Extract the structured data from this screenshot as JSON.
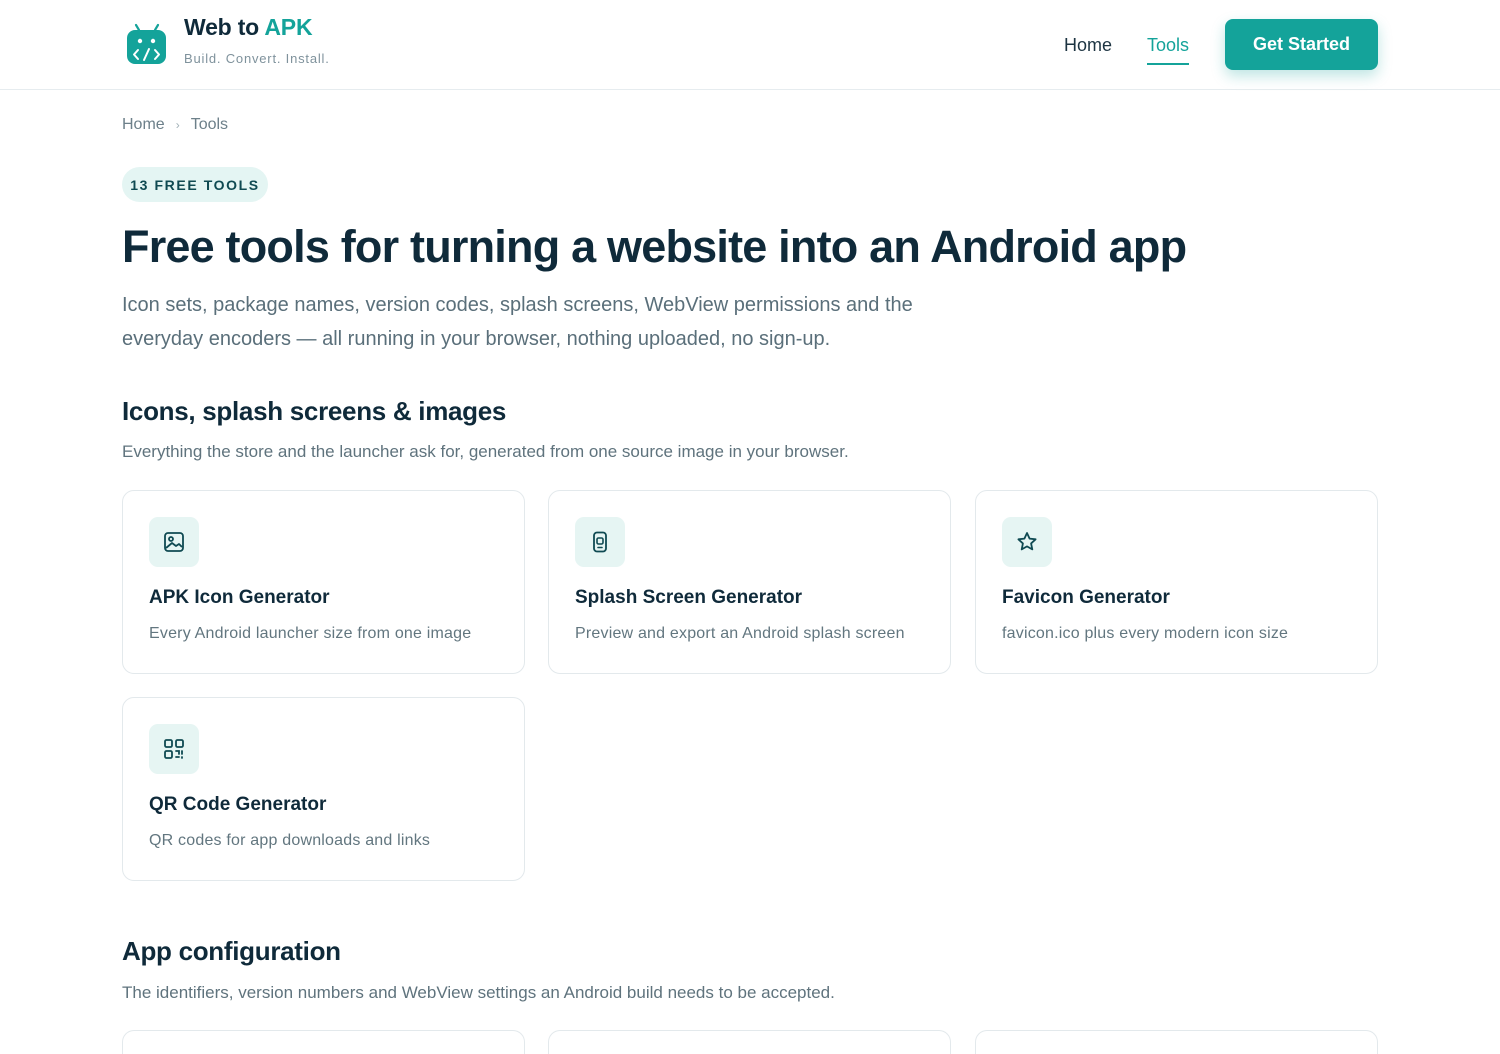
{
  "header": {
    "brand_name": "Web to",
    "brand_accent": "APK",
    "tagline": "Build. Convert. Install.",
    "nav": [
      {
        "label": "Home",
        "active": false
      },
      {
        "label": "Tools",
        "active": true
      }
    ],
    "cta_label": "Get Started",
    "logo_icon": "android-code-icon"
  },
  "breadcrumb": {
    "items": [
      "Home",
      "Tools"
    ],
    "separator": "›"
  },
  "hero": {
    "badge": "13 FREE TOOLS",
    "title": "Free tools for turning a website into an Android app",
    "subtitle": "Icon sets, package names, version codes, splash screens, WebView permissions and the everyday encoders — all running in your browser, nothing uploaded, no sign-up."
  },
  "sections": [
    {
      "title": "Icons, splash screens & images",
      "description": "Everything the store and the launcher ask for, generated from one source image in your browser.",
      "tools": [
        {
          "title": "APK Icon Generator",
          "description": "Every Android launcher size from one image",
          "icon": "image-icon"
        },
        {
          "title": "Splash Screen Generator",
          "description": "Preview and export an Android splash screen",
          "icon": "phone-icon"
        },
        {
          "title": "Favicon Generator",
          "description": "favicon.ico plus every modern icon size",
          "icon": "star-icon"
        },
        {
          "title": "QR Code Generator",
          "description": "QR codes for app downloads and links",
          "icon": "qr-code-icon"
        }
      ]
    },
    {
      "title": "App configuration",
      "description": "The identifiers, version numbers and WebView settings an Android build needs to be accepted."
    }
  ],
  "colors": {
    "accent": "#14a39a",
    "heading": "#0f2a3a",
    "icon_bg": "#e6f5f3",
    "border": "#e3e9ec"
  }
}
